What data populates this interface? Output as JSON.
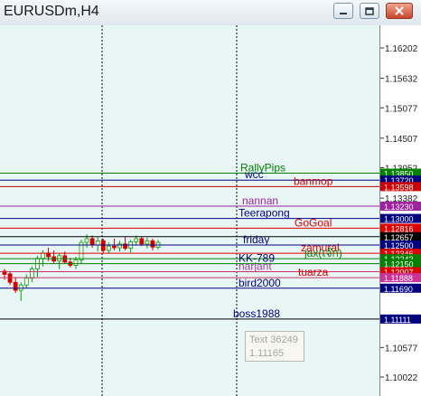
{
  "window": {
    "title": "EURUSDm,H4"
  },
  "axis_ticks": [
    {
      "label": "1.16202",
      "price": 1.16202
    },
    {
      "label": "1.15632",
      "price": 1.15632
    },
    {
      "label": "1.15077",
      "price": 1.15077
    },
    {
      "label": "1.14507",
      "price": 1.14507
    },
    {
      "label": "1.13952",
      "price": 1.13952
    },
    {
      "label": "1.13382",
      "price": 1.13382
    },
    {
      "label": "1.10577",
      "price": 1.10577
    },
    {
      "label": "1.10022",
      "price": 1.10022
    }
  ],
  "levels": [
    {
      "name": "RallyPips",
      "price": 1.1385,
      "label": "1.13850",
      "color": "#008000",
      "text_color": "#008000",
      "badge_color": "#008000"
    },
    {
      "name": "wcc",
      "price": 1.1372,
      "label": "1.13720",
      "color": "#000080",
      "text_color": "#000080",
      "badge_color": "#000080"
    },
    {
      "name": "banmop",
      "price": 1.13598,
      "label": "1.13598",
      "color": "#cc0000",
      "text_color": "#cc0000",
      "badge_color": "#cc0000"
    },
    {
      "name": "nannan",
      "price": 1.1323,
      "label": "1.13230",
      "color": "#a020a0",
      "text_color": "#a020a0",
      "badge_color": "#a020a0"
    },
    {
      "name": "Teerapong",
      "price": 1.13,
      "label": "1.13000",
      "color": "#000080",
      "text_color": "#000080",
      "badge_color": "#000080"
    },
    {
      "name": "GoGoal",
      "price": 1.12816,
      "label": "1.12816",
      "color": "#dd0000",
      "text_color": "#dd0000",
      "badge_color": "#dd0000"
    },
    {
      "name": "",
      "price": 1.12657,
      "label": "1.12657",
      "color": "#000000",
      "text_color": "#000000",
      "badge_color": "#000000"
    },
    {
      "name": "friday",
      "price": 1.125,
      "label": "1.12500",
      "color": "#000080",
      "text_color": "#000080",
      "badge_color": "#000080"
    },
    {
      "name": "zamurai",
      "price": 1.12346,
      "label": "1.12346",
      "color": "#dd0000",
      "text_color": "#dd0000",
      "badge_color": "#dd0000"
    },
    {
      "name": "jax(เจ๊ก)",
      "price": 1.12243,
      "label": "1.12243",
      "color": "#008000",
      "text_color": "#008000",
      "badge_color": "#008000"
    },
    {
      "name": "KK-789",
      "price": 1.1215,
      "label": "1.12150",
      "color": "#008000",
      "text_color": "#000080",
      "badge_color": "#008000"
    },
    {
      "name": "narjant",
      "price": 1.12,
      "label": "1.12007",
      "color": "#cc3366",
      "text_color": "#a040a0",
      "badge_color": "#dd0000"
    },
    {
      "name": "tuarza",
      "price": 1.11888,
      "label": "1.11888",
      "color": "#cc3366",
      "text_color": "#cc0000",
      "badge_color": "#cc3399"
    },
    {
      "name": "bird2000",
      "price": 1.1169,
      "label": "1.11690",
      "color": "#000080",
      "text_color": "#000080",
      "badge_color": "#000080"
    },
    {
      "name": "boss1988",
      "price": 1.11111,
      "label": "1.11111",
      "color": "#000000",
      "text_color": "#000080",
      "badge_color": "#000080"
    }
  ],
  "text_object": {
    "line1": "Text 36249",
    "line2": "1.11165"
  },
  "candles": [
    {
      "o": 1.1201,
      "h": 1.1205,
      "l": 1.1185,
      "c": 1.1195
    },
    {
      "o": 1.1196,
      "h": 1.12,
      "l": 1.1175,
      "c": 1.118
    },
    {
      "o": 1.118,
      "h": 1.119,
      "l": 1.116,
      "c": 1.1165
    },
    {
      "o": 1.1165,
      "h": 1.118,
      "l": 1.1145,
      "c": 1.1175
    },
    {
      "o": 1.1175,
      "h": 1.1195,
      "l": 1.117,
      "c": 1.1188
    },
    {
      "o": 1.1188,
      "h": 1.121,
      "l": 1.118,
      "c": 1.1205
    },
    {
      "o": 1.1205,
      "h": 1.123,
      "l": 1.119,
      "c": 1.1225
    },
    {
      "o": 1.1225,
      "h": 1.124,
      "l": 1.121,
      "c": 1.1235
    },
    {
      "o": 1.1235,
      "h": 1.1245,
      "l": 1.122,
      "c": 1.1228
    },
    {
      "o": 1.1228,
      "h": 1.124,
      "l": 1.1215,
      "c": 1.122
    },
    {
      "o": 1.122,
      "h": 1.1235,
      "l": 1.1205,
      "c": 1.123
    },
    {
      "o": 1.123,
      "h": 1.1238,
      "l": 1.1215,
      "c": 1.1218
    },
    {
      "o": 1.1218,
      "h": 1.1226,
      "l": 1.1208,
      "c": 1.1212
    },
    {
      "o": 1.1212,
      "h": 1.1228,
      "l": 1.1205,
      "c": 1.1222
    },
    {
      "o": 1.1222,
      "h": 1.126,
      "l": 1.1215,
      "c": 1.1255
    },
    {
      "o": 1.1255,
      "h": 1.127,
      "l": 1.1245,
      "c": 1.1262
    },
    {
      "o": 1.1262,
      "h": 1.1268,
      "l": 1.1245,
      "c": 1.125
    },
    {
      "o": 1.125,
      "h": 1.1265,
      "l": 1.1238,
      "c": 1.1258
    },
    {
      "o": 1.1258,
      "h": 1.1262,
      "l": 1.1235,
      "c": 1.124
    },
    {
      "o": 1.124,
      "h": 1.1255,
      "l": 1.1235,
      "c": 1.1248
    },
    {
      "o": 1.1248,
      "h": 1.1262,
      "l": 1.124,
      "c": 1.1245
    },
    {
      "o": 1.1245,
      "h": 1.1258,
      "l": 1.1238,
      "c": 1.1252
    },
    {
      "o": 1.1252,
      "h": 1.1265,
      "l": 1.124,
      "c": 1.1244
    },
    {
      "o": 1.1244,
      "h": 1.126,
      "l": 1.1236,
      "c": 1.1256
    },
    {
      "o": 1.1256,
      "h": 1.1268,
      "l": 1.125,
      "c": 1.1262
    },
    {
      "o": 1.1262,
      "h": 1.1266,
      "l": 1.1248,
      "c": 1.1252
    },
    {
      "o": 1.1252,
      "h": 1.1264,
      "l": 1.1244,
      "c": 1.1258
    },
    {
      "o": 1.1258,
      "h": 1.1262,
      "l": 1.124,
      "c": 1.1246
    },
    {
      "o": 1.1246,
      "h": 1.126,
      "l": 1.1242,
      "c": 1.1255
    }
  ]
}
